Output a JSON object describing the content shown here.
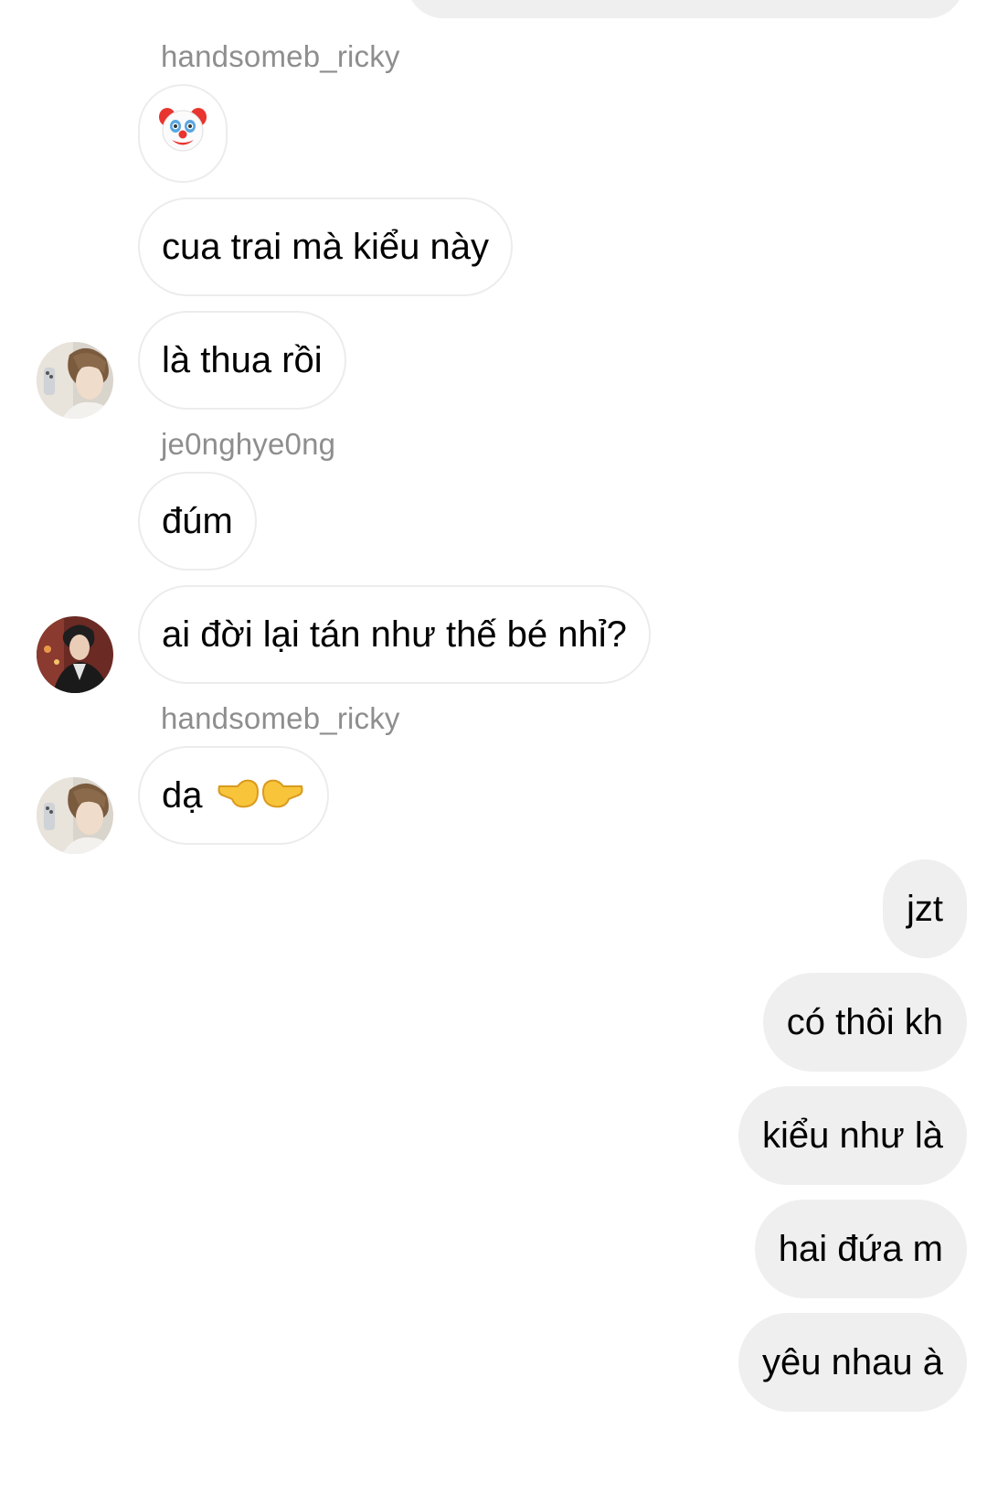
{
  "thread": {
    "groups": [
      {
        "sender": "handsomeb_ricky"
      },
      {
        "sender": "je0nghye0ng"
      },
      {
        "sender": "handsomeb_ricky"
      }
    ],
    "messages": [
      {
        "text": "",
        "emoji": "clown-face"
      },
      {
        "text": "cua trai mà kiểu này"
      },
      {
        "text": "là thua rồi"
      },
      {
        "text": "đúm"
      },
      {
        "text": "ai đời lại tán như thế bé nhỉ?"
      },
      {
        "text": "dạ",
        "emoji": "backhand-index-pointing-left-and-right"
      },
      {
        "text": "jzt"
      },
      {
        "text": "có thôi kh"
      },
      {
        "text": "kiểu như là"
      },
      {
        "text": "hai đứa m"
      },
      {
        "text": "yêu nhau à"
      }
    ]
  },
  "colors": {
    "incoming_bubble_bg": "#ffffff",
    "incoming_bubble_border": "#ececec",
    "outgoing_bubble_bg": "#efefef",
    "sender_name": "#8e8e8e",
    "text": "#000000"
  },
  "icons": {
    "avatar_ricky": "profile-photo",
    "avatar_jeonghyeong": "profile-photo"
  }
}
